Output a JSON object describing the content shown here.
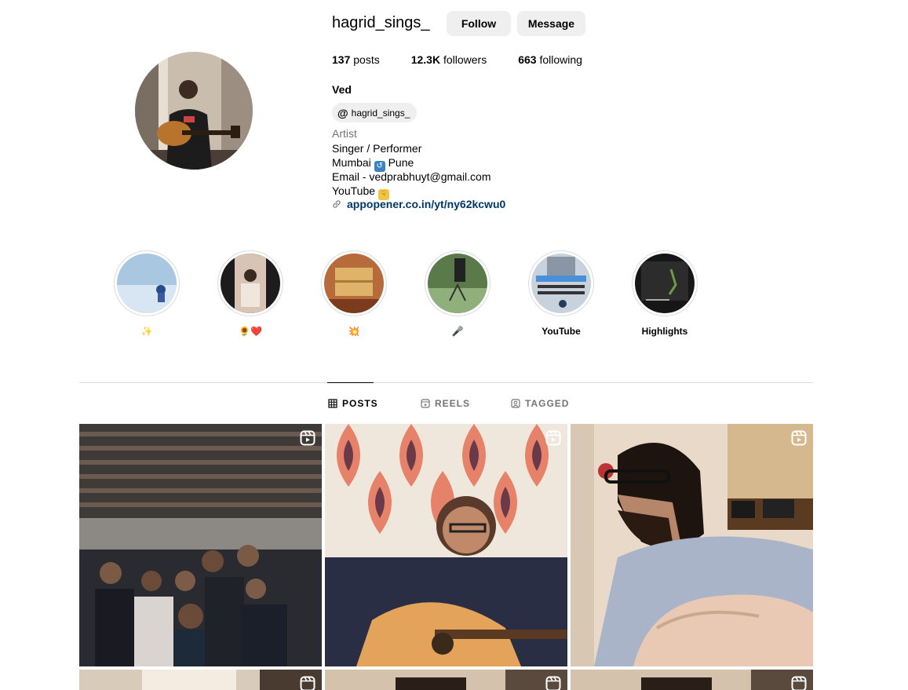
{
  "profile": {
    "username": "hagrid_sings_",
    "follow_label": "Follow",
    "message_label": "Message",
    "stats": [
      {
        "value": "137",
        "label": "posts"
      },
      {
        "value": "12.3K",
        "label": "followers"
      },
      {
        "value": "663",
        "label": "following"
      }
    ],
    "full_name": "Ved",
    "threads_handle": "hagrid_sings_",
    "category": "Artist",
    "bio": {
      "line1": "Singer / Performer",
      "line2_a": "Mumbai",
      "line2_b": "Pune",
      "line3": "Email - vedprabhuyt@gmail.com",
      "line4": "YouTube"
    },
    "link": "appopener.co.in/yt/ny62kcwu0"
  },
  "highlights": [
    {
      "label": "✨",
      "icon": "sparkles"
    },
    {
      "label": "🌻❤️",
      "icon": "sunflower-heart"
    },
    {
      "label": "💥",
      "icon": "burst"
    },
    {
      "label": "🎤",
      "icon": "microphone"
    },
    {
      "label": "YouTube",
      "icon": "youtube"
    },
    {
      "label": "Highlights",
      "icon": "highlights"
    }
  ],
  "tabs": [
    {
      "label": "POSTS",
      "icon": "grid-icon"
    },
    {
      "label": "REELS",
      "icon": "reels-icon"
    },
    {
      "label": "TAGGED",
      "icon": "tagged-icon"
    }
  ],
  "colors": {
    "link": "#00376b",
    "button_bg": "#efefef",
    "divider": "#dbdbdb",
    "muted": "#737373"
  }
}
